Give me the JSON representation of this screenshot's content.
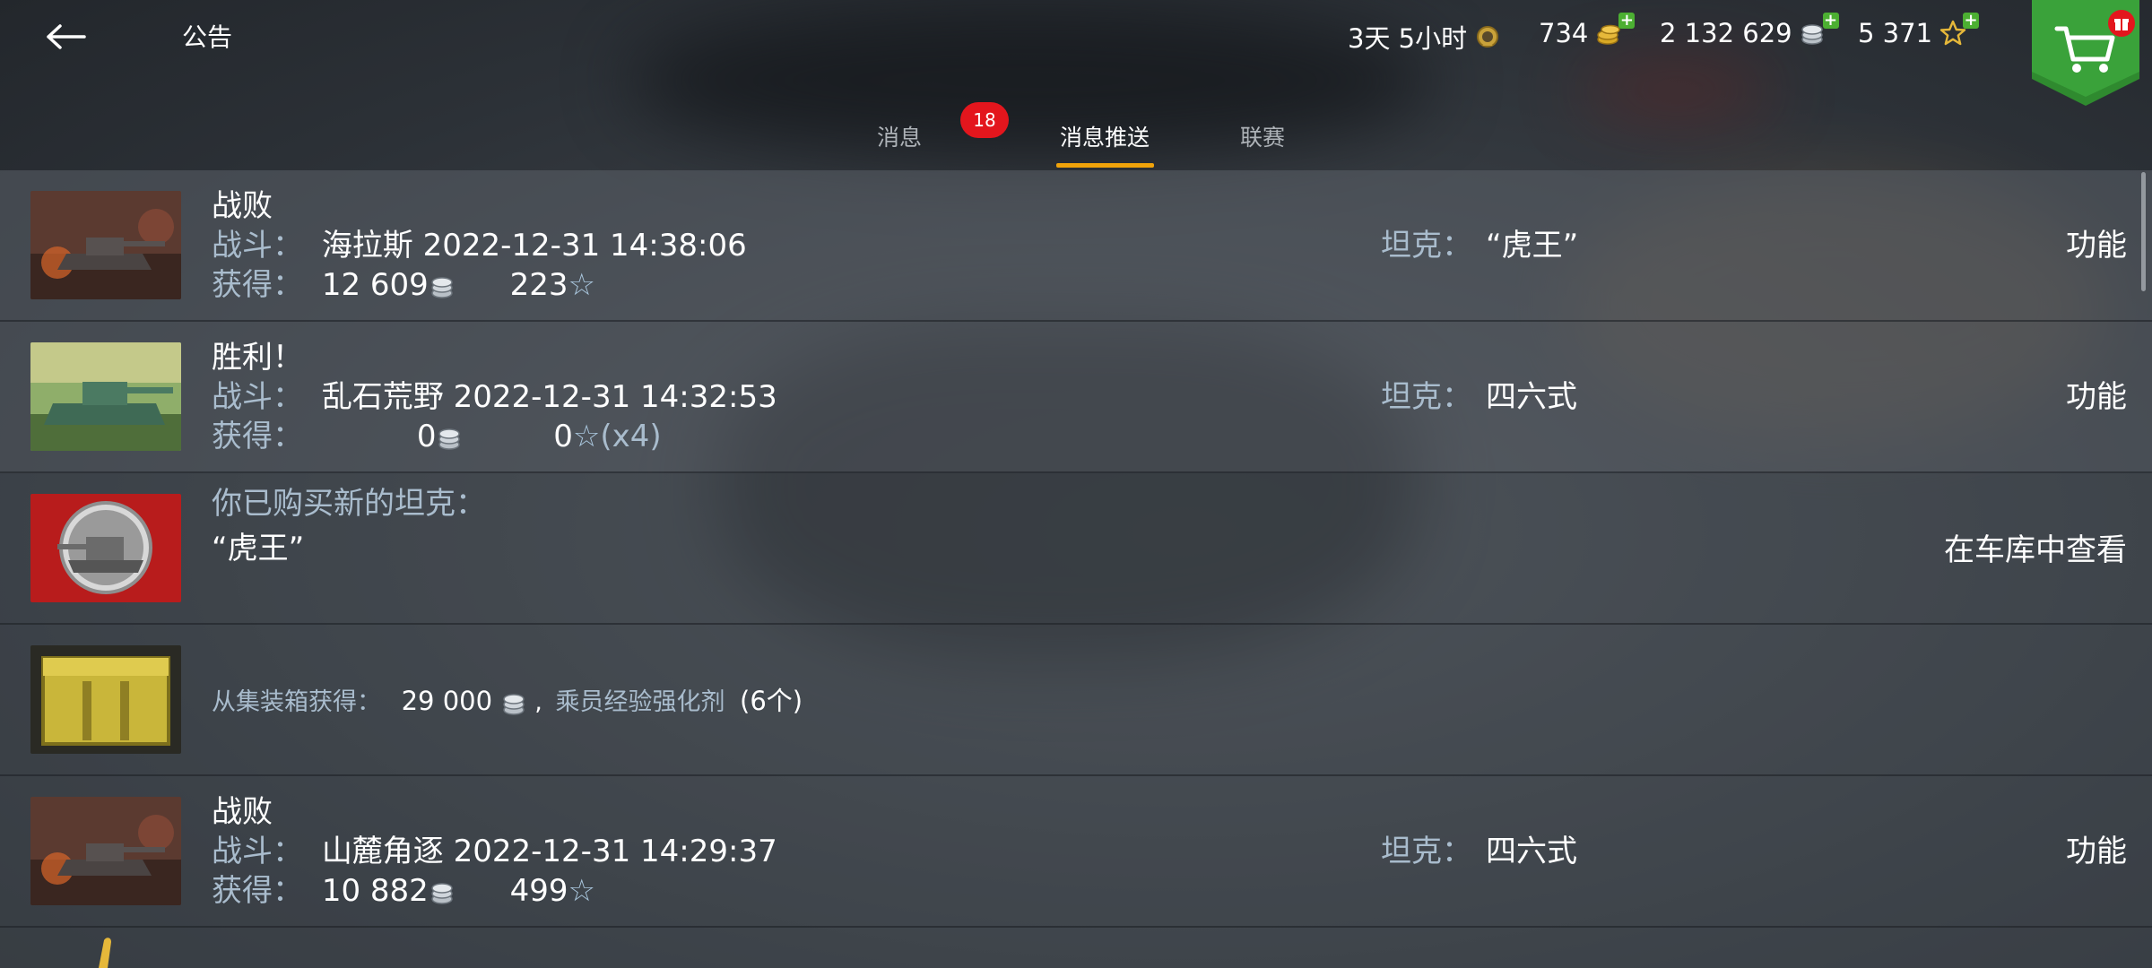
{
  "header": {
    "title": "公告",
    "timer": "3天 5小时",
    "gold": "734",
    "credits": "2 132 629",
    "free_xp": "5 371"
  },
  "tabs": [
    {
      "label": "消息",
      "badge": "18"
    },
    {
      "label": "消息推送"
    },
    {
      "label": "联赛"
    }
  ],
  "messages": [
    {
      "title": "战败",
      "battle_label": "战斗：",
      "battle_value": "海拉斯 2022-12-31 14:38:06",
      "earn_label": "获得：",
      "credits": "12 609",
      "xp": "223",
      "tank_label": "坦克：",
      "tank_value": "“虎王”",
      "action": "功能"
    },
    {
      "title": "胜利！",
      "battle_label": "战斗：",
      "battle_value": "乱石荒野 2022-12-31 14:32:53",
      "earn_label": "获得：",
      "credits": "0",
      "xp": "0",
      "xp_mult": "(x4)",
      "tank_label": "坦克：",
      "tank_value": "四六式",
      "action": "功能"
    },
    {
      "title": "你已购买新的坦克：",
      "tank_name": "“虎王”",
      "action": "在车库中查看"
    },
    {
      "source_label": "从集装箱获得：",
      "credits": "29 000",
      "sep": ",",
      "item_name": "乘员经验强化剂",
      "item_count": "(6个)"
    },
    {
      "title": "战败",
      "battle_label": "战斗：",
      "battle_value": "山麓角逐 2022-12-31 14:29:37",
      "earn_label": "获得：",
      "credits": "10 882",
      "xp": "499",
      "tank_label": "坦克：",
      "tank_value": "四六式",
      "action": "功能"
    }
  ],
  "icons": {
    "back": "arrow-left-icon",
    "timer_badge": "rank-medal-icon",
    "gold": "gold-coins-icon",
    "credits": "silver-coins-icon",
    "free_xp": "star-icon",
    "shop": "cart-icon",
    "gift": "gift-icon"
  },
  "colors": {
    "accent": "#f0a30a",
    "badge": "#e3161d",
    "plus": "#4caf32",
    "label": "#a9bccd",
    "shop": "#2f8a2f"
  }
}
